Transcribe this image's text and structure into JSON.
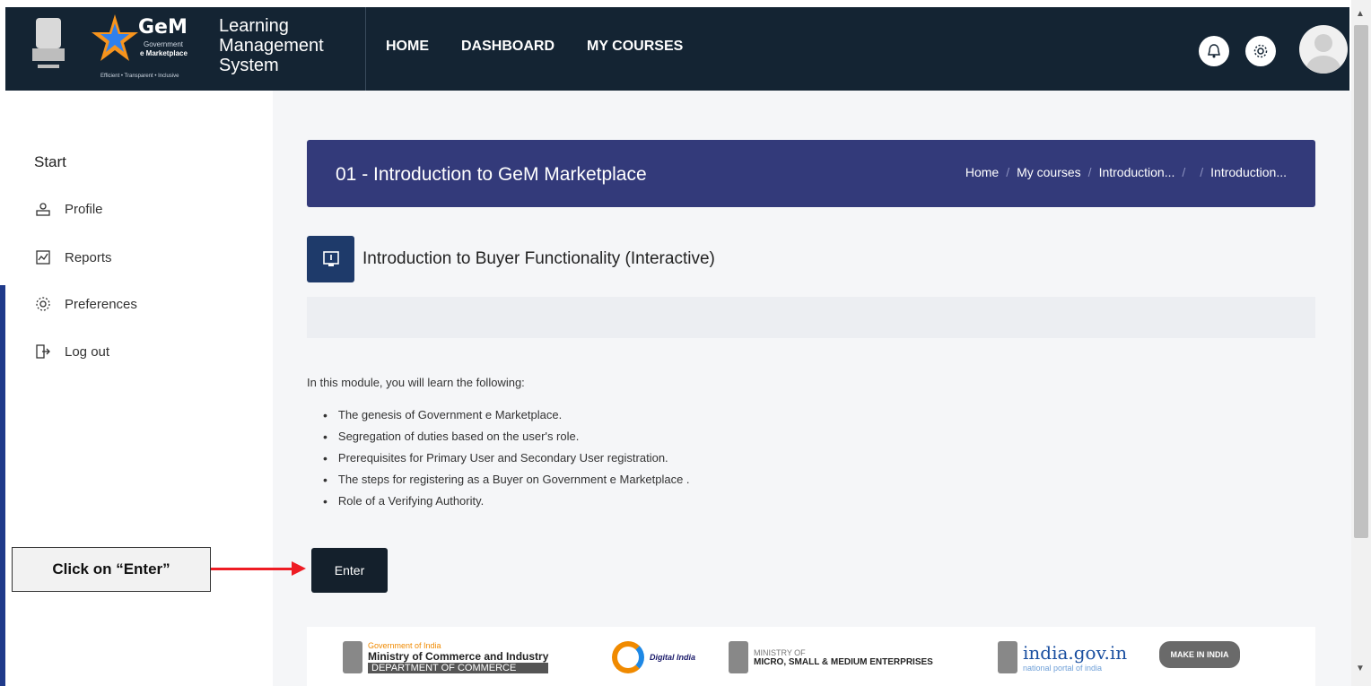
{
  "header": {
    "gem_name": "GeM",
    "gem_sub_line1": "Government",
    "gem_sub_line2": "e Marketplace",
    "gem_tagline": "Efficient • Transparent • Inclusive",
    "lms_title": "Learning Management System",
    "nav": [
      "HOME",
      "DASHBOARD",
      "MY COURSES"
    ],
    "icons": [
      "bell-icon",
      "gear-icon",
      "user-avatar"
    ]
  },
  "sidebar": {
    "start_label": "Start",
    "items": [
      {
        "label": "Profile",
        "icon": "profile-icon"
      },
      {
        "label": "Reports",
        "icon": "reports-icon"
      },
      {
        "label": "Preferences",
        "icon": "preferences-icon"
      },
      {
        "label": "Log out",
        "icon": "logout-icon"
      }
    ]
  },
  "banner": {
    "title": "01 - Introduction to GeM Marketplace",
    "breadcrumb": [
      "Home",
      "My courses",
      "Introduction...",
      "",
      "Introduction..."
    ]
  },
  "module": {
    "title": "Introduction to Buyer Functionality (Interactive)",
    "intro": "In this module, you will learn the following:",
    "bullets": [
      "The genesis of Government e Marketplace.",
      "Segregation of duties based on the user's role.",
      "Prerequisites for Primary User and Secondary User registration.",
      "The steps for registering as a Buyer on Government e Marketplace .",
      "Role of a Verifying Authority."
    ],
    "enter_label": "Enter"
  },
  "footer": {
    "commerce_small": "Government of India",
    "commerce_main": "Ministry of Commerce and Industry",
    "commerce_dept": "DEPARTMENT OF COMMERCE",
    "digital_india": "Digital India",
    "msme_small": "MINISTRY OF",
    "msme_main": "MICRO, SMALL & MEDIUM ENTERPRISES",
    "india_gov": "india.gov.in",
    "india_gov_sub": "national portal of india",
    "make_in_india": "MAKE IN INDIA"
  },
  "annotation": {
    "callout": "Click on “Enter”",
    "arrow_color": "#ee1c24"
  },
  "colors": {
    "header_bg": "#142433",
    "banner_bg": "#333a7a",
    "button_bg": "#14202c"
  }
}
